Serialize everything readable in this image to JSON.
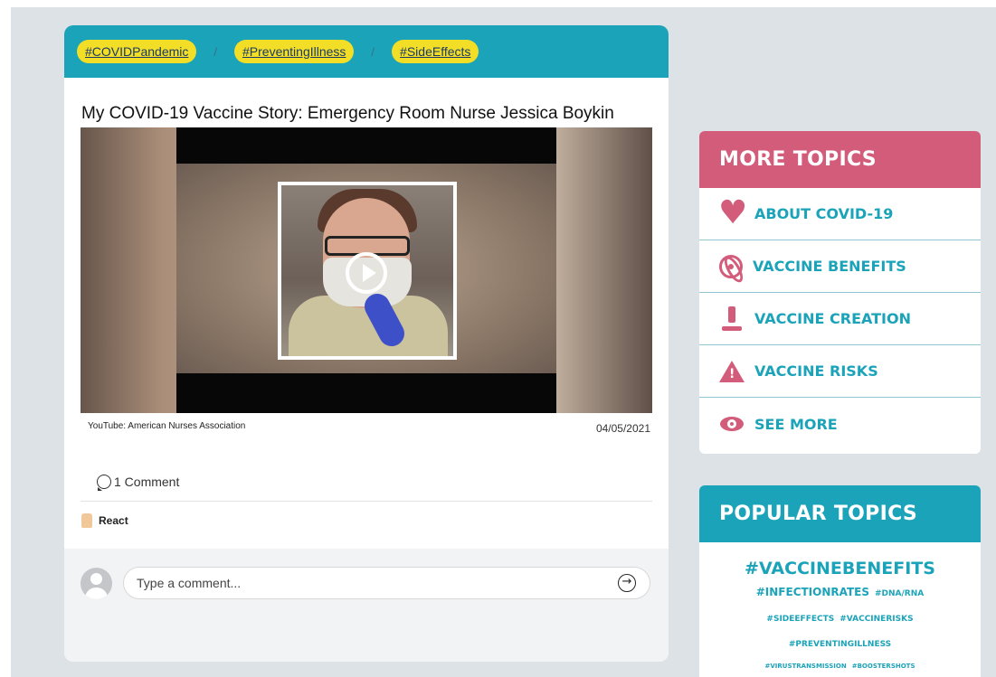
{
  "post": {
    "tags": [
      "#COVIDPandemic",
      "#PreventingIllness",
      "#SideEffects"
    ],
    "tag_separator": "/",
    "title": "My COVID-19 Vaccine Story: Emergency Room Nurse Jessica Boykin",
    "video_source": "YouTube: American Nurses Association",
    "date": "04/05/2021",
    "comment_count": "1 Comment",
    "react_label": "React",
    "comment_placeholder": "Type a comment..."
  },
  "more_topics": {
    "title": "MORE TOPICS",
    "items": [
      {
        "label": "ABOUT COVID-19",
        "icon": "heart-icon"
      },
      {
        "label": "VACCINE BENEFITS",
        "icon": "atom-icon"
      },
      {
        "label": "VACCINE CREATION",
        "icon": "microscope-icon"
      },
      {
        "label": "VACCINE RISKS",
        "icon": "warning-icon"
      },
      {
        "label": "SEE MORE",
        "icon": "eye-icon"
      }
    ]
  },
  "popular_topics": {
    "title": "POPULAR TOPICS",
    "hashtags": [
      "#VACCINEBENEFITS",
      "#INFECTIONRATES",
      "#DNA/RNA",
      "#SIDEEFFECTS",
      "#VACCINERISKS",
      "#PREVENTINGILLNESS",
      "#VIRUSTRANSMISSION",
      "#BOOSTERSHOTS"
    ]
  },
  "colors": {
    "teal": "#1ba3b9",
    "pink": "#d35c7b",
    "tag_yellow": "#f2de26",
    "background": "#dde2e6"
  }
}
